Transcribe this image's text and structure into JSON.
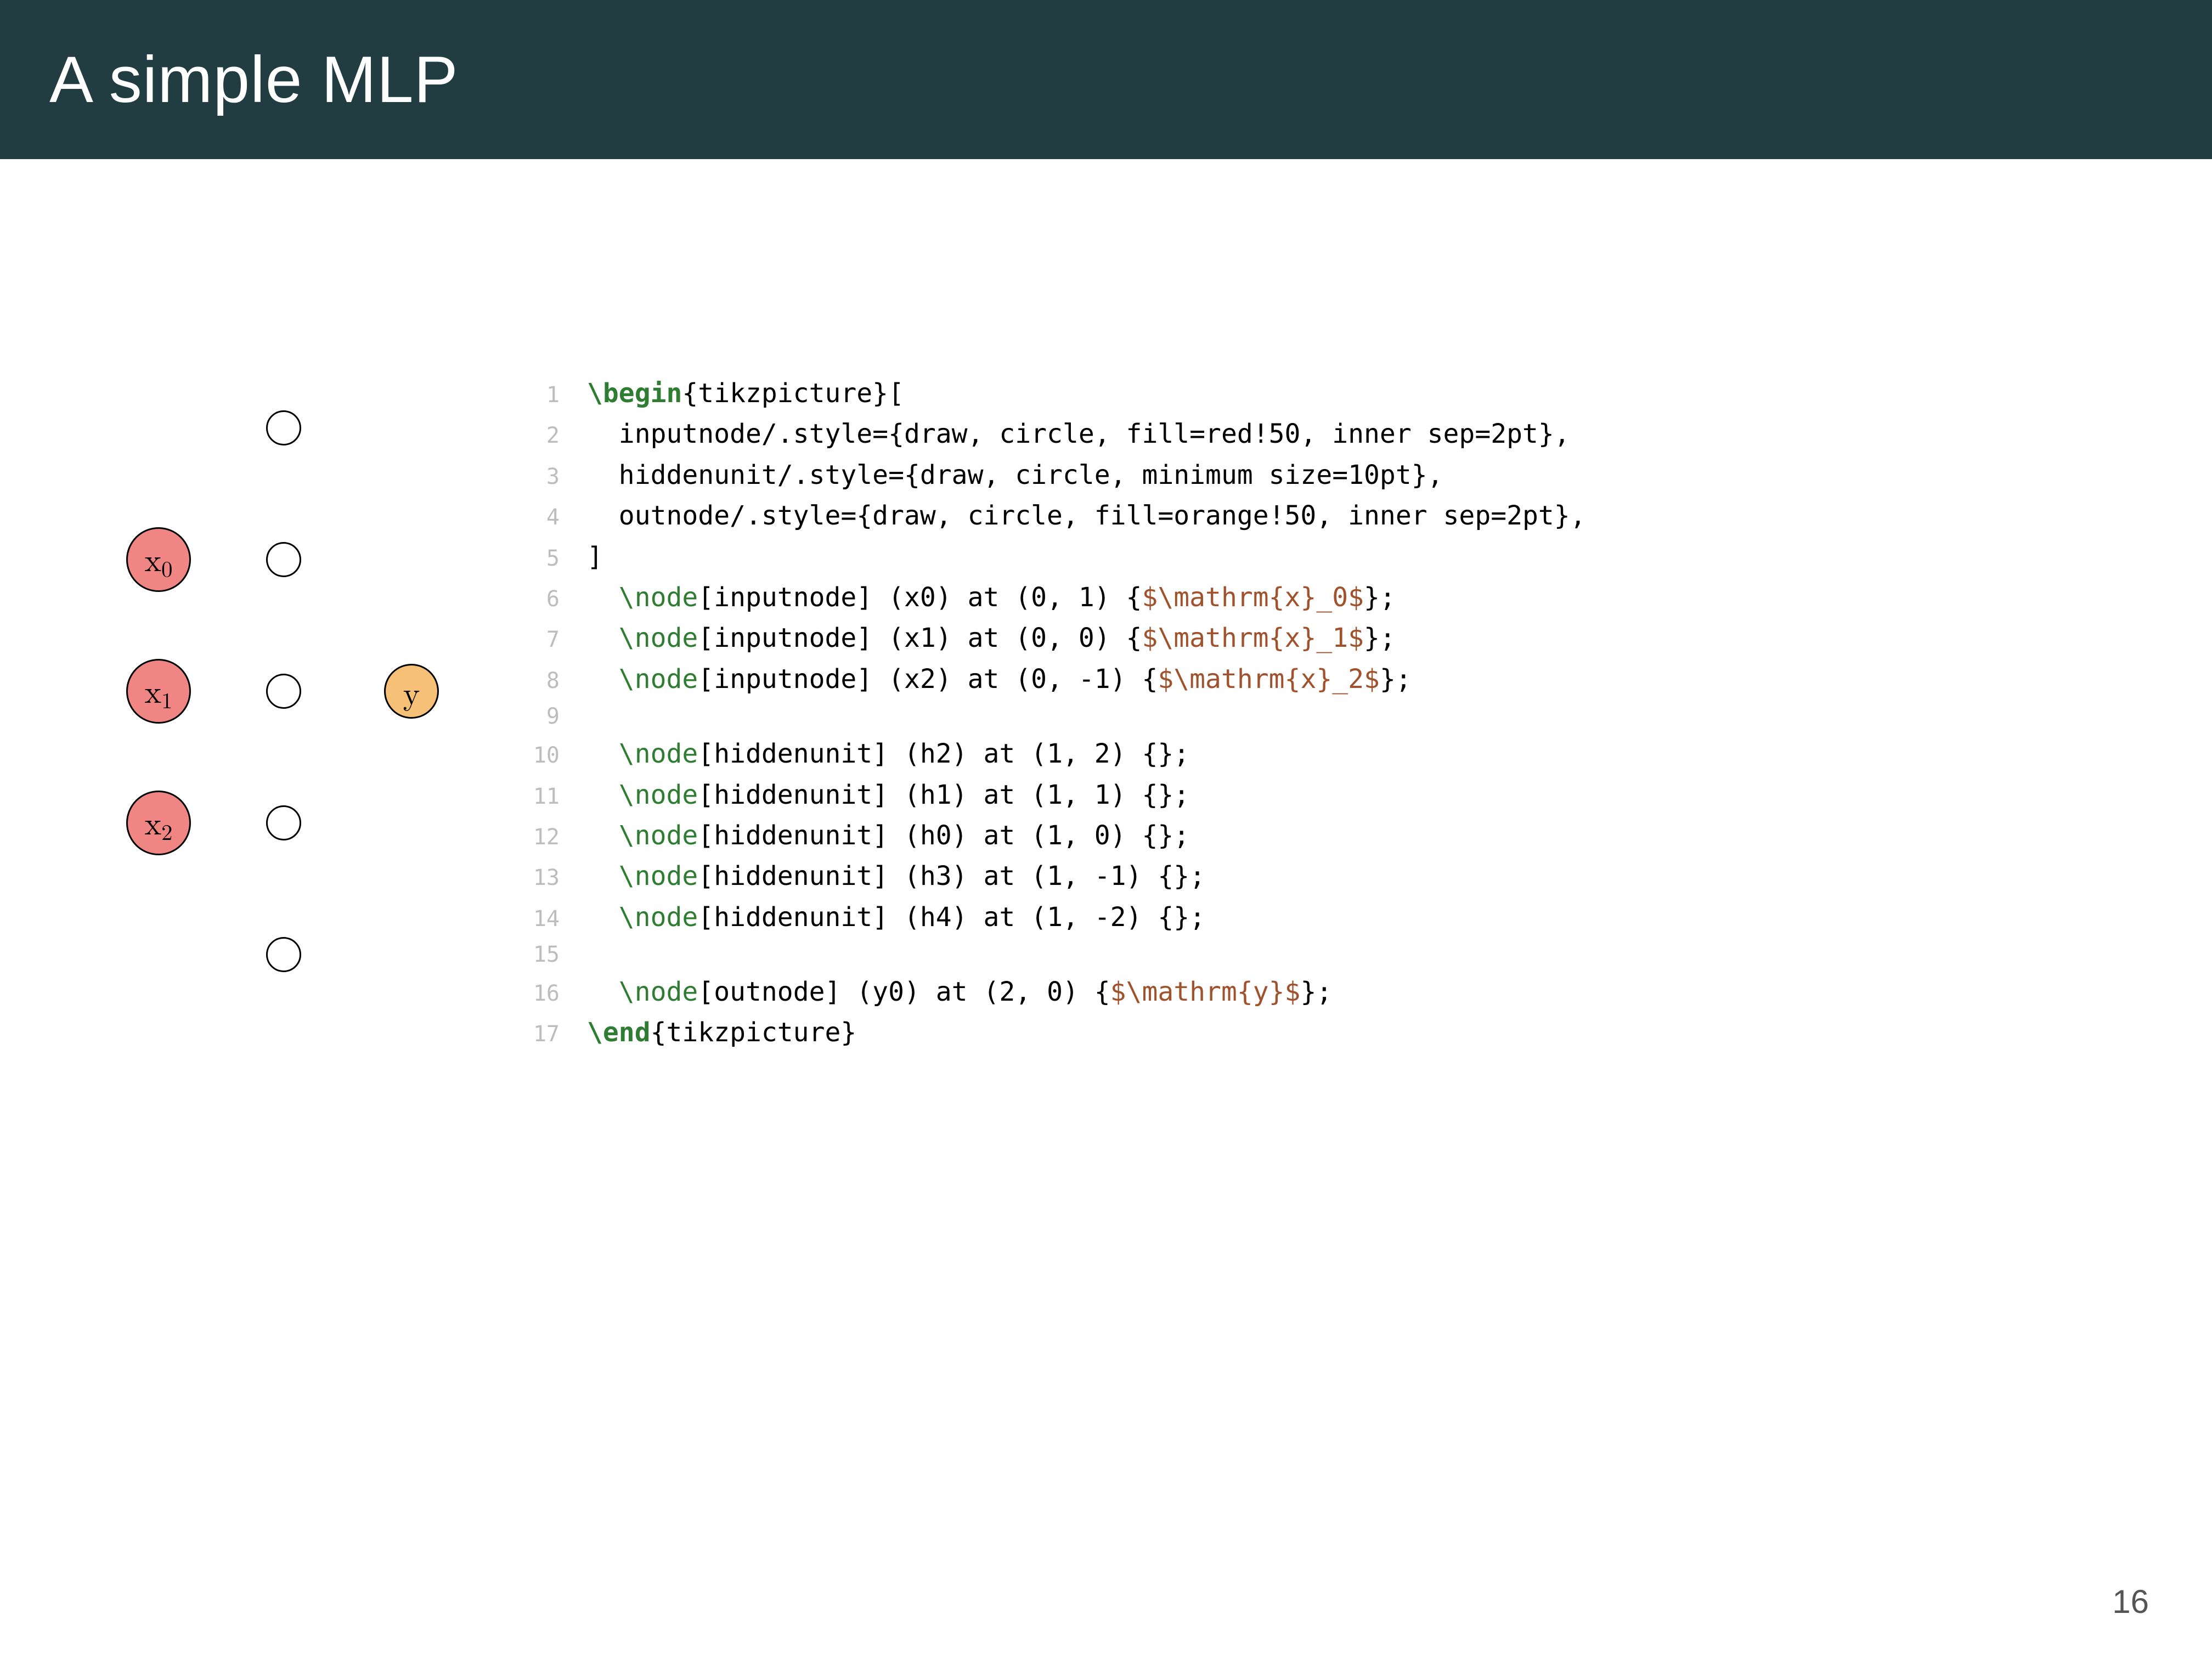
{
  "title": "A simple MLP",
  "page_number": "16",
  "diagram": {
    "input_nodes": [
      {
        "label_base": "x",
        "label_sub": "0"
      },
      {
        "label_base": "x",
        "label_sub": "1"
      },
      {
        "label_base": "x",
        "label_sub": "2"
      }
    ],
    "hidden_count": 5,
    "output_label": "y"
  },
  "code": {
    "lines": [
      {
        "n": "1",
        "segs": [
          {
            "t": "\\begin",
            "c": "tok-kw"
          },
          {
            "t": "{tikzpicture}[",
            "c": "plain"
          }
        ]
      },
      {
        "n": "2",
        "segs": [
          {
            "t": "  inputnode/.style={draw, circle, fill=red!50, inner sep=2pt},",
            "c": "plain"
          }
        ]
      },
      {
        "n": "3",
        "segs": [
          {
            "t": "  hiddenunit/.style={draw, circle, minimum size=10pt},",
            "c": "plain"
          }
        ]
      },
      {
        "n": "4",
        "segs": [
          {
            "t": "  outnode/.style={draw, circle, fill=orange!50, inner sep=2pt},",
            "c": "plain"
          }
        ]
      },
      {
        "n": "5",
        "segs": [
          {
            "t": "]",
            "c": "plain"
          }
        ]
      },
      {
        "n": "6",
        "segs": [
          {
            "t": "  ",
            "c": "plain"
          },
          {
            "t": "\\node",
            "c": "tok-cmd"
          },
          {
            "t": "[inputnode] (x0) at (0, 1) {",
            "c": "plain"
          },
          {
            "t": "$\\mathrm{x}_0$",
            "c": "tok-math"
          },
          {
            "t": "};",
            "c": "plain"
          }
        ]
      },
      {
        "n": "7",
        "segs": [
          {
            "t": "  ",
            "c": "plain"
          },
          {
            "t": "\\node",
            "c": "tok-cmd"
          },
          {
            "t": "[inputnode] (x1) at (0, 0) {",
            "c": "plain"
          },
          {
            "t": "$\\mathrm{x}_1$",
            "c": "tok-math"
          },
          {
            "t": "};",
            "c": "plain"
          }
        ]
      },
      {
        "n": "8",
        "segs": [
          {
            "t": "  ",
            "c": "plain"
          },
          {
            "t": "\\node",
            "c": "tok-cmd"
          },
          {
            "t": "[inputnode] (x2) at (0, -1) {",
            "c": "plain"
          },
          {
            "t": "$\\mathrm{x}_2$",
            "c": "tok-math"
          },
          {
            "t": "};",
            "c": "plain"
          }
        ]
      },
      {
        "n": "9",
        "segs": [
          {
            "t": "",
            "c": "plain"
          }
        ]
      },
      {
        "n": "10",
        "segs": [
          {
            "t": "  ",
            "c": "plain"
          },
          {
            "t": "\\node",
            "c": "tok-cmd"
          },
          {
            "t": "[hiddenunit] (h2) at (1, 2) {};",
            "c": "plain"
          }
        ]
      },
      {
        "n": "11",
        "segs": [
          {
            "t": "  ",
            "c": "plain"
          },
          {
            "t": "\\node",
            "c": "tok-cmd"
          },
          {
            "t": "[hiddenunit] (h1) at (1, 1) {};",
            "c": "plain"
          }
        ]
      },
      {
        "n": "12",
        "segs": [
          {
            "t": "  ",
            "c": "plain"
          },
          {
            "t": "\\node",
            "c": "tok-cmd"
          },
          {
            "t": "[hiddenunit] (h0) at (1, 0) {};",
            "c": "plain"
          }
        ]
      },
      {
        "n": "13",
        "segs": [
          {
            "t": "  ",
            "c": "plain"
          },
          {
            "t": "\\node",
            "c": "tok-cmd"
          },
          {
            "t": "[hiddenunit] (h3) at (1, -1) {};",
            "c": "plain"
          }
        ]
      },
      {
        "n": "14",
        "segs": [
          {
            "t": "  ",
            "c": "plain"
          },
          {
            "t": "\\node",
            "c": "tok-cmd"
          },
          {
            "t": "[hiddenunit] (h4) at (1, -2) {};",
            "c": "plain"
          }
        ]
      },
      {
        "n": "15",
        "segs": [
          {
            "t": "",
            "c": "plain"
          }
        ]
      },
      {
        "n": "16",
        "segs": [
          {
            "t": "  ",
            "c": "plain"
          },
          {
            "t": "\\node",
            "c": "tok-cmd"
          },
          {
            "t": "[outnode] (y0) at (2, 0) {",
            "c": "plain"
          },
          {
            "t": "$\\mathrm{y}$",
            "c": "tok-math"
          },
          {
            "t": "};",
            "c": "plain"
          }
        ]
      },
      {
        "n": "17",
        "segs": [
          {
            "t": "\\end",
            "c": "tok-kw"
          },
          {
            "t": "{tikzpicture}",
            "c": "plain"
          }
        ]
      }
    ]
  }
}
